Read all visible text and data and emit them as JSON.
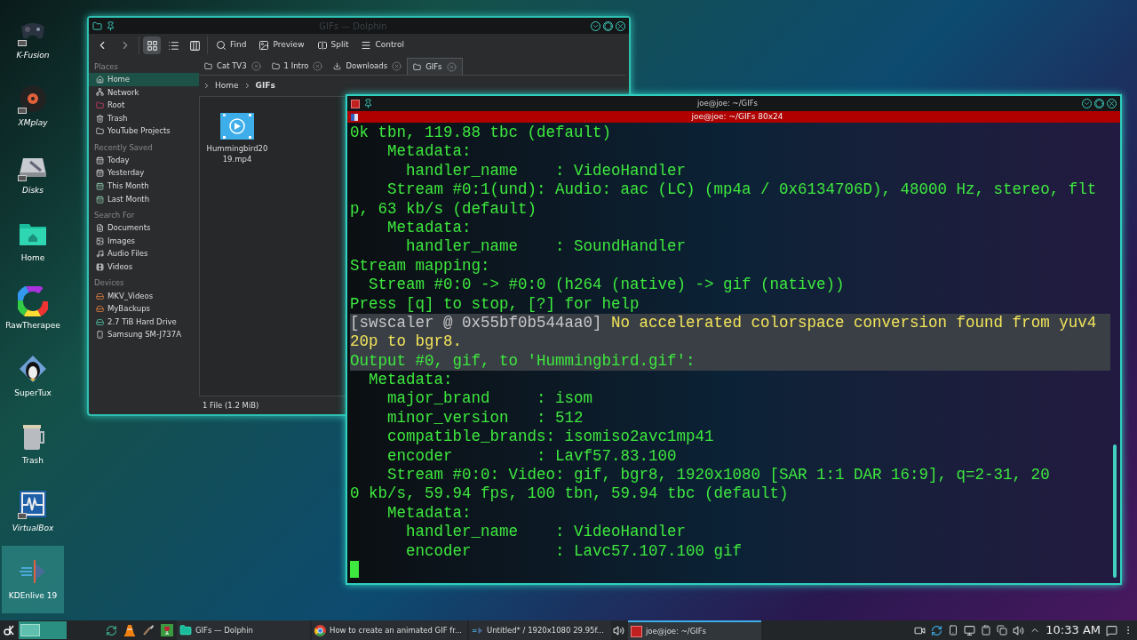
{
  "desktop_icons": [
    {
      "label": "K-Fusion",
      "link": true,
      "selected": false
    },
    {
      "label": "XMplay",
      "link": true,
      "selected": false
    },
    {
      "label": "Disks",
      "link": true,
      "selected": false
    },
    {
      "label": "Home",
      "link": false,
      "selected": false
    },
    {
      "label": "RawTherapee",
      "link": false,
      "selected": false
    },
    {
      "label": "SuperTux",
      "link": false,
      "selected": false
    },
    {
      "label": "Trash",
      "link": false,
      "selected": false
    },
    {
      "label": "VirtualBox",
      "link": true,
      "selected": false
    },
    {
      "label": "KDEnlive 19",
      "link": false,
      "selected": true
    }
  ],
  "dolphin": {
    "title": "GIFs — Dolphin",
    "view_modes": [
      {
        "selected": true
      },
      {
        "selected": false
      },
      {
        "selected": false
      }
    ],
    "toolbar": [
      "Find",
      "Preview",
      "Split",
      "Control"
    ],
    "places": [
      {
        "heading": "Places",
        "items": [
          {
            "label": "Home",
            "selected": true
          },
          {
            "label": "Network",
            "selected": false
          },
          {
            "label": "Root",
            "selected": false
          },
          {
            "label": "Trash",
            "selected": false
          },
          {
            "label": "YouTube Projects",
            "selected": false
          }
        ]
      },
      {
        "heading": "Recently Saved",
        "items": [
          {
            "label": "Today",
            "selected": false
          },
          {
            "label": "Yesterday",
            "selected": false
          },
          {
            "label": "This Month",
            "selected": false
          },
          {
            "label": "Last Month",
            "selected": false
          }
        ]
      },
      {
        "heading": "Search For",
        "items": [
          {
            "label": "Documents",
            "selected": false
          },
          {
            "label": "Images",
            "selected": false
          },
          {
            "label": "Audio Files",
            "selected": false
          },
          {
            "label": "Videos",
            "selected": false
          }
        ]
      },
      {
        "heading": "Devices",
        "items": [
          {
            "label": "MKV_Videos",
            "selected": false
          },
          {
            "label": "MyBackups",
            "selected": false
          },
          {
            "label": "2.7 TiB Hard Drive",
            "selected": false
          },
          {
            "label": "Samsung SM-J737A",
            "selected": false
          }
        ]
      }
    ],
    "tabs": [
      {
        "label": "Cat TV3",
        "selected": false
      },
      {
        "label": "1 Intro",
        "selected": false
      },
      {
        "label": "Downloads",
        "selected": false
      },
      {
        "label": "GIFs",
        "selected": true
      }
    ],
    "breadcrumb": [
      "Home",
      "GIFs"
    ],
    "files": [
      {
        "name": "Hummingbird2019.mp4"
      }
    ],
    "status": "1 File (1.2 MiB)"
  },
  "terminal": {
    "title": "joe@joe: ~/GIFs",
    "tab_title": "joe@joe: ~/GIFs 80x24",
    "lines": [
      {
        "kind": "output",
        "text": "0k tbn, 119.88 tbc (default)",
        "selected": false
      },
      {
        "kind": "output",
        "text": "    Metadata:",
        "selected": false
      },
      {
        "kind": "output",
        "text": "      handler_name    : VideoHandler",
        "selected": false
      },
      {
        "kind": "output",
        "text": "    Stream #0:1(und): Audio: aac (LC) (mp4a / 0x6134706D), 48000 Hz, stereo, flt",
        "selected": false
      },
      {
        "kind": "output",
        "text": "p, 63 kb/s (default)",
        "selected": false
      },
      {
        "kind": "output",
        "text": "    Metadata:",
        "selected": false
      },
      {
        "kind": "output",
        "text": "      handler_name    : SoundHandler",
        "selected": false
      },
      {
        "kind": "output",
        "text": "Stream mapping:",
        "selected": false
      },
      {
        "kind": "output",
        "text": "  Stream #0:0 -> #0:0 (h264 (native) -> gif (native))",
        "selected": false
      },
      {
        "kind": "output",
        "text": "Press [q] to stop, [?] for help",
        "selected": false
      },
      {
        "kind": "warning",
        "prefix": "[swscaler @ 0x55bf0b544aa0]",
        "text": " No accelerated colorspace conversion found from yuv4",
        "selected": true
      },
      {
        "kind": "warning",
        "text": "20p to bgr8.",
        "selected": true
      },
      {
        "kind": "output",
        "text": "Output #0, gif, to 'Hummingbird.gif':",
        "selected": true
      },
      {
        "kind": "output",
        "text": "  Metadata:",
        "selected": false
      },
      {
        "kind": "output",
        "text": "    major_brand     : isom",
        "selected": false
      },
      {
        "kind": "output",
        "text": "    minor_version   : 512",
        "selected": false
      },
      {
        "kind": "output",
        "text": "    compatible_brands: isomiso2avc1mp41",
        "selected": false
      },
      {
        "kind": "output",
        "text": "    encoder         : Lavf57.83.100",
        "selected": false
      },
      {
        "kind": "output",
        "text": "    Stream #0:0: Video: gif, bgr8, 1920x1080 [SAR 1:1 DAR 16:9], q=2-31, 20",
        "selected": false
      },
      {
        "kind": "output",
        "text": "0 kb/s, 59.94 fps, 100 tbn, 59.94 tbc (default)",
        "selected": false
      },
      {
        "kind": "output",
        "text": "    Metadata:",
        "selected": false
      },
      {
        "kind": "output",
        "text": "      handler_name    : VideoHandler",
        "selected": false
      },
      {
        "kind": "output",
        "text": "      encoder         : Lavc57.107.100 gif",
        "selected": false
      }
    ]
  },
  "taskbar": {
    "tasks": [
      {
        "label": "GIFs — Dolphin",
        "selected": false
      },
      {
        "label": "How to create an animated GIF fr...",
        "selected": false
      },
      {
        "label": "Untitled* / 1920x1080 29.95f...",
        "selected": false
      },
      {
        "label": "joe@joe: ~/GIFs",
        "selected": true
      }
    ],
    "clock": "10:33 AM"
  }
}
